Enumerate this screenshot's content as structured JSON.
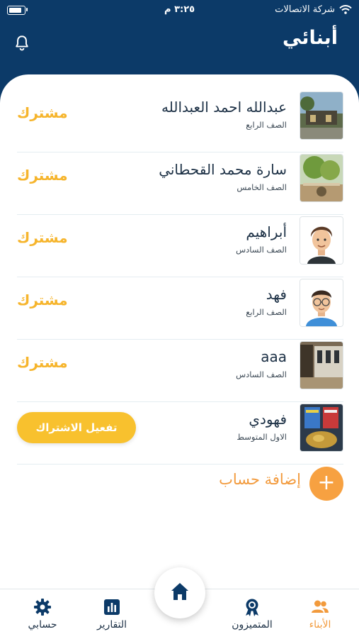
{
  "status_bar": {
    "carrier": "شركة الاتصالات",
    "time": "٣:٢٥ م"
  },
  "header": {
    "title": "أبنائي"
  },
  "children": [
    {
      "name": "عبدالله احمد  العبدالله",
      "grade": "الصف الرابع",
      "status": "مشترك",
      "photo": "house-photo"
    },
    {
      "name": "سارة محمد القحطاني",
      "grade": "الصف الخامس",
      "status": "مشترك",
      "photo": "garden-photo"
    },
    {
      "name": "أبراهيم",
      "grade": "الصف السادس",
      "status": "مشترك",
      "photo": "boy-avatar"
    },
    {
      "name": "فهد",
      "grade": "الصف الرابع",
      "status": "مشترك",
      "photo": "boy-glasses-avatar"
    },
    {
      "name": "aaa",
      "grade": "الصف السادس",
      "status": "مشترك",
      "photo": "building-photo"
    },
    {
      "name": "فهودي",
      "grade": "الاول المتوسط",
      "status": "",
      "action": "تفعيل الاشتراك",
      "photo": "shop-photo"
    }
  ],
  "add_account": {
    "label": "إضافة حساب",
    "icon": "plus-icon"
  },
  "tabs": [
    {
      "label": "الأبناء",
      "icon": "people-icon",
      "active": true
    },
    {
      "label": "المتميزون",
      "icon": "award-icon",
      "active": false
    },
    {
      "label": "",
      "icon": "home-icon",
      "active": false
    },
    {
      "label": "التقارير",
      "icon": "chart-icon",
      "active": false
    },
    {
      "label": "حسابي",
      "icon": "gear-icon",
      "active": false
    }
  ],
  "colors": {
    "header_bg": "#0c3a68",
    "subscribed": "#f6b52d",
    "activate_button": "#f8c12e",
    "add_button": "#f7a141",
    "active_tab": "#f29a3c"
  }
}
